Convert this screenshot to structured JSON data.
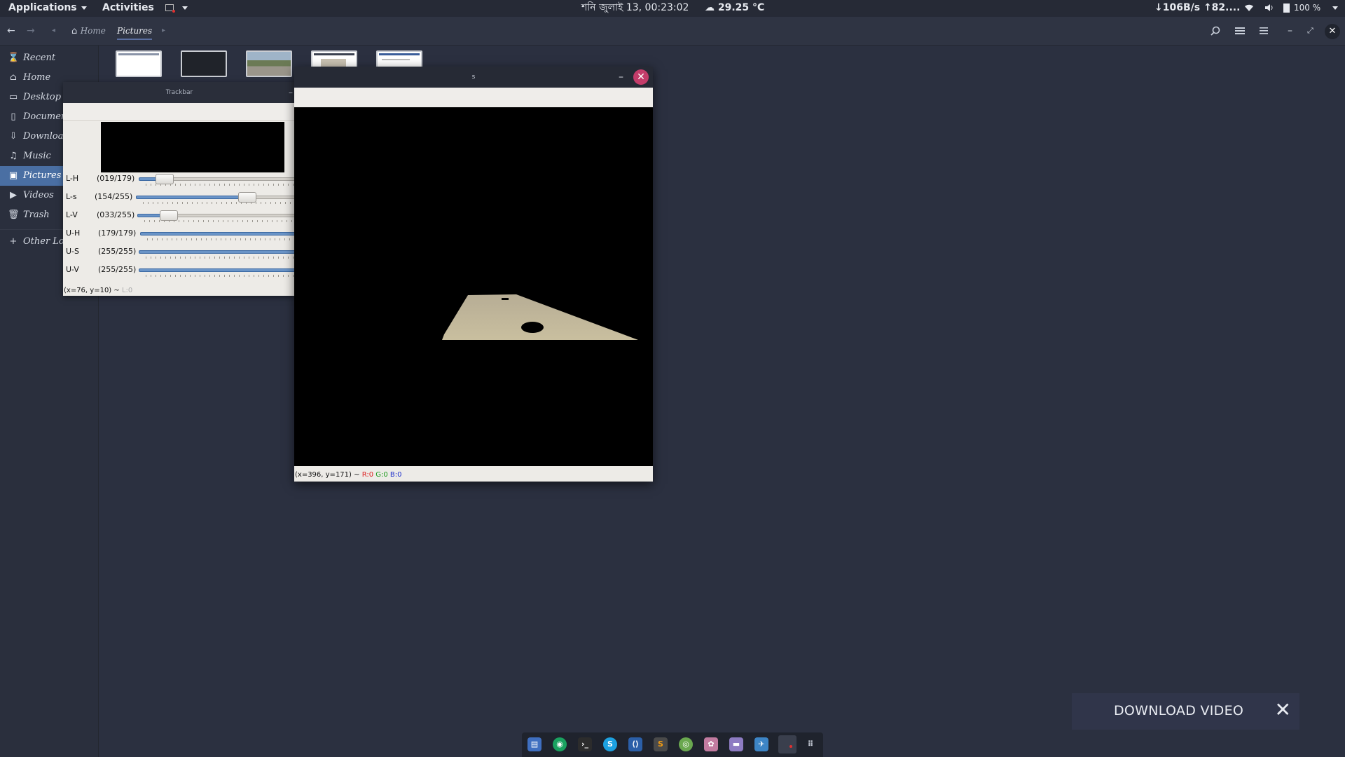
{
  "topbar": {
    "applications": "Applications",
    "activities": "Activities",
    "clock": "শনি জুলাই 13, 00:23:02",
    "weather": "29.25 °C",
    "network": "↓106B/s ↑82....",
    "battery": "100 %"
  },
  "fileman": {
    "breadcrumb": [
      "Home",
      "Pictures"
    ],
    "sidebar": [
      {
        "label": "Recent",
        "icon": "clock-icon"
      },
      {
        "label": "Home",
        "icon": "home-icon"
      },
      {
        "label": "Desktop",
        "icon": "desktop-icon"
      },
      {
        "label": "Documents",
        "icon": "document-icon"
      },
      {
        "label": "Downloads",
        "icon": "download-icon"
      },
      {
        "label": "Music",
        "icon": "music-icon"
      },
      {
        "label": "Pictures",
        "icon": "pictures-icon"
      },
      {
        "label": "Videos",
        "icon": "video-icon"
      },
      {
        "label": "Trash",
        "icon": "trash-icon"
      },
      {
        "label": "Other Locations",
        "icon": "plus-icon"
      }
    ]
  },
  "trackbar_win": {
    "title": "Trackbar",
    "sliders": [
      {
        "name": "L-H",
        "value": "(019/179)",
        "level": 0.106
      },
      {
        "name": "L-s",
        "value": "(154/255)",
        "level": 0.604
      },
      {
        "name": "L-V",
        "value": "(033/255)",
        "level": 0.129
      },
      {
        "name": "U-H",
        "value": "(179/179)",
        "level": 1.0
      },
      {
        "name": "U-S",
        "value": "(255/255)",
        "level": 1.0
      },
      {
        "name": "U-V",
        "value": "(255/255)",
        "level": 1.0
      }
    ],
    "status": "(x=76, y=10) ~",
    "status_extra": "L:0"
  },
  "s_win": {
    "title": "s",
    "status_coords": "(x=396, y=171) ~",
    "status_r": "R:0",
    "status_g": "G:0",
    "status_b": "B:0"
  },
  "download": {
    "label": "DOWNLOAD VIDEO"
  },
  "colors": {
    "accent": "#4a6fa3",
    "close": "#c43c6a"
  }
}
